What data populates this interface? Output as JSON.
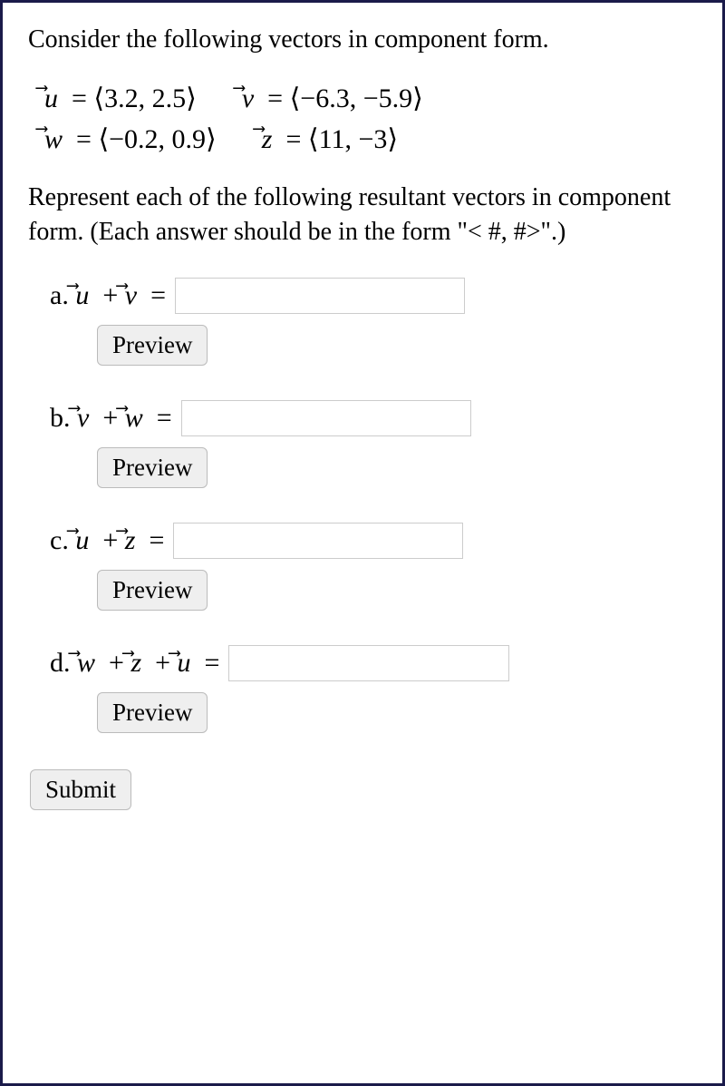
{
  "intro": "Consider the following vectors in component form.",
  "vectors": {
    "u": {
      "sym": "u",
      "text": "⟨3.2, 2.5⟩"
    },
    "v": {
      "sym": "v",
      "text": "⟨−6.3, −5.9⟩"
    },
    "w": {
      "sym": "w",
      "text": "⟨−0.2, 0.9⟩"
    },
    "z": {
      "sym": "z",
      "text": "⟨11, −3⟩"
    }
  },
  "instruction": "Represent each of the following resultant vectors in component form. (Each answer should be in the form \"< #, #>\".)",
  "questions": {
    "a": {
      "letter": "a.",
      "expr_html": "vec_u_plus_v"
    },
    "b": {
      "letter": "b.",
      "expr_html": "vec_v_plus_w"
    },
    "c": {
      "letter": "c.",
      "expr_html": "vec_u_plus_z"
    },
    "d": {
      "letter": "d.",
      "expr_html": "vec_w_plus_z_plus_u"
    }
  },
  "buttons": {
    "preview": "Preview",
    "submit": "Submit"
  }
}
